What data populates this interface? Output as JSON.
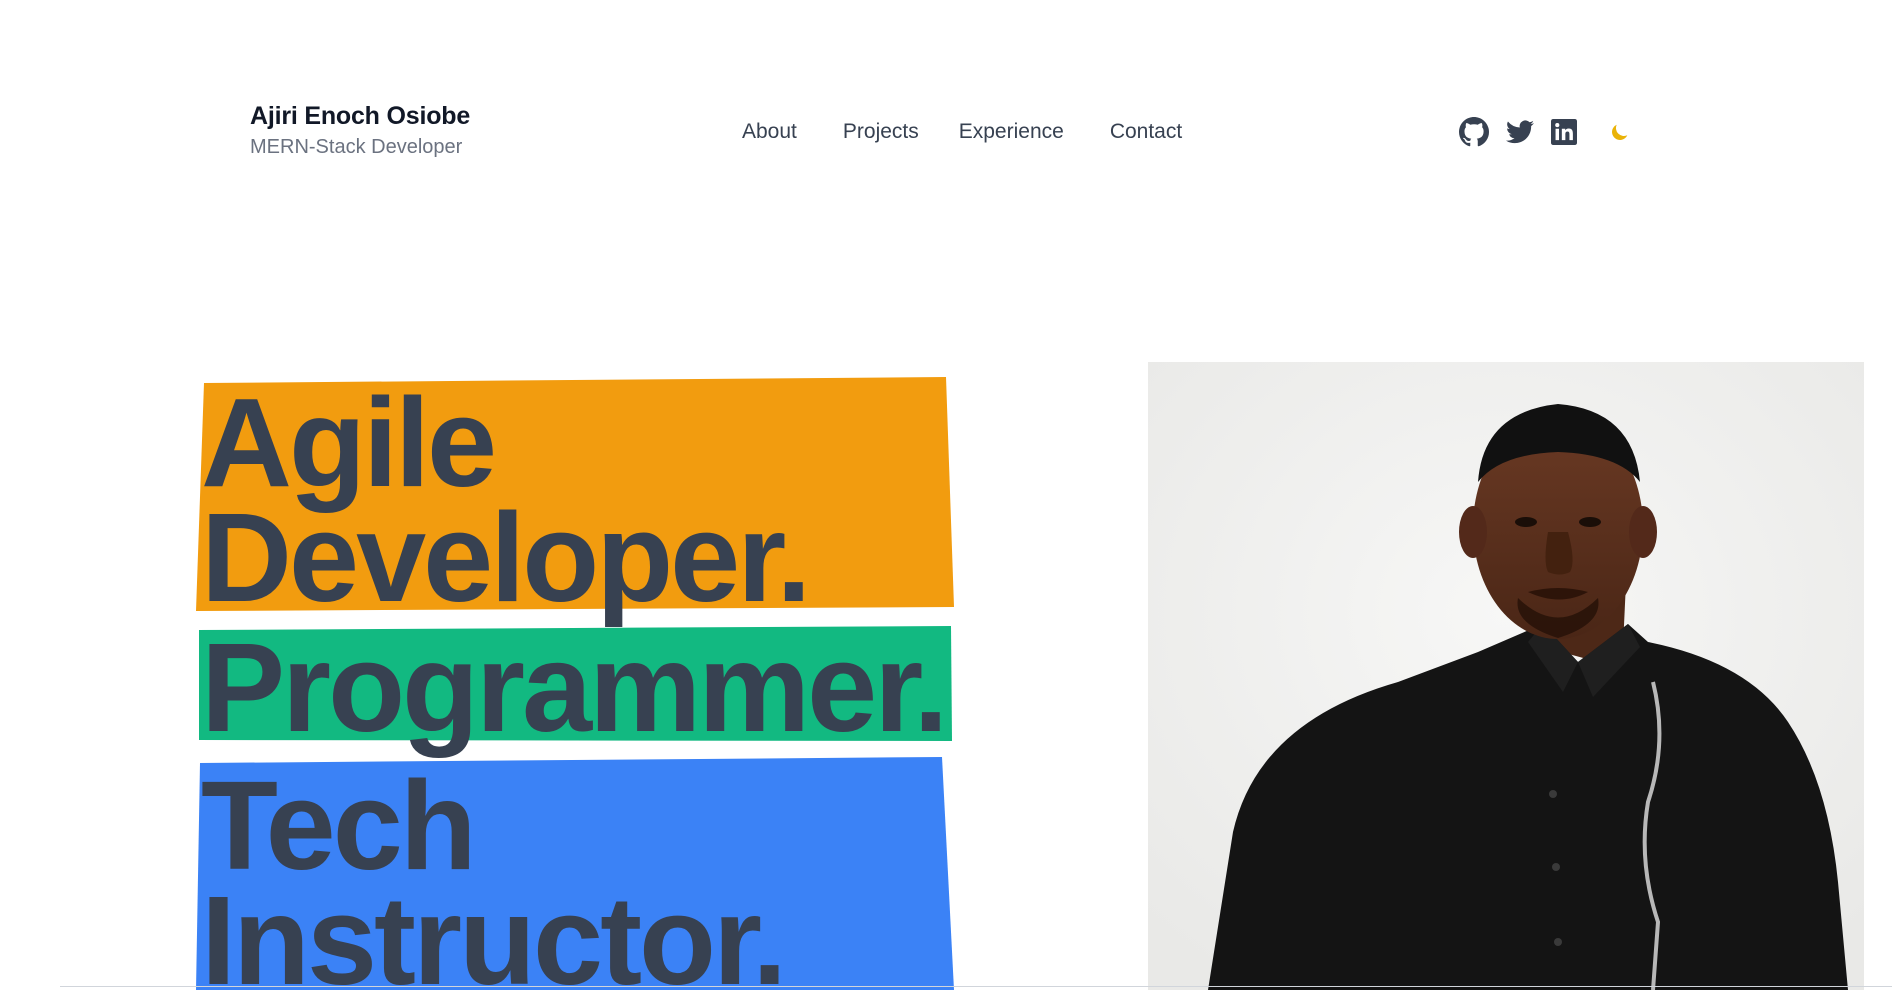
{
  "header": {
    "name": "Ajiri Enoch Osiobe",
    "role": "MERN-Stack Developer"
  },
  "nav": {
    "items": [
      "About",
      "Projects",
      "Experience",
      "Contact"
    ]
  },
  "social": {
    "icons": [
      "github-icon",
      "twitter-icon",
      "linkedin-icon",
      "moon-icon"
    ],
    "theme_toggle_color": "#eab308"
  },
  "hero": {
    "lines": [
      "Agile",
      "Developer.",
      "Programmer.",
      "Tech",
      "Instructor."
    ],
    "band_colors": {
      "orange": "#f29c0f",
      "green": "#12b981",
      "blue": "#3b82f6"
    },
    "text_color": "#374151"
  }
}
